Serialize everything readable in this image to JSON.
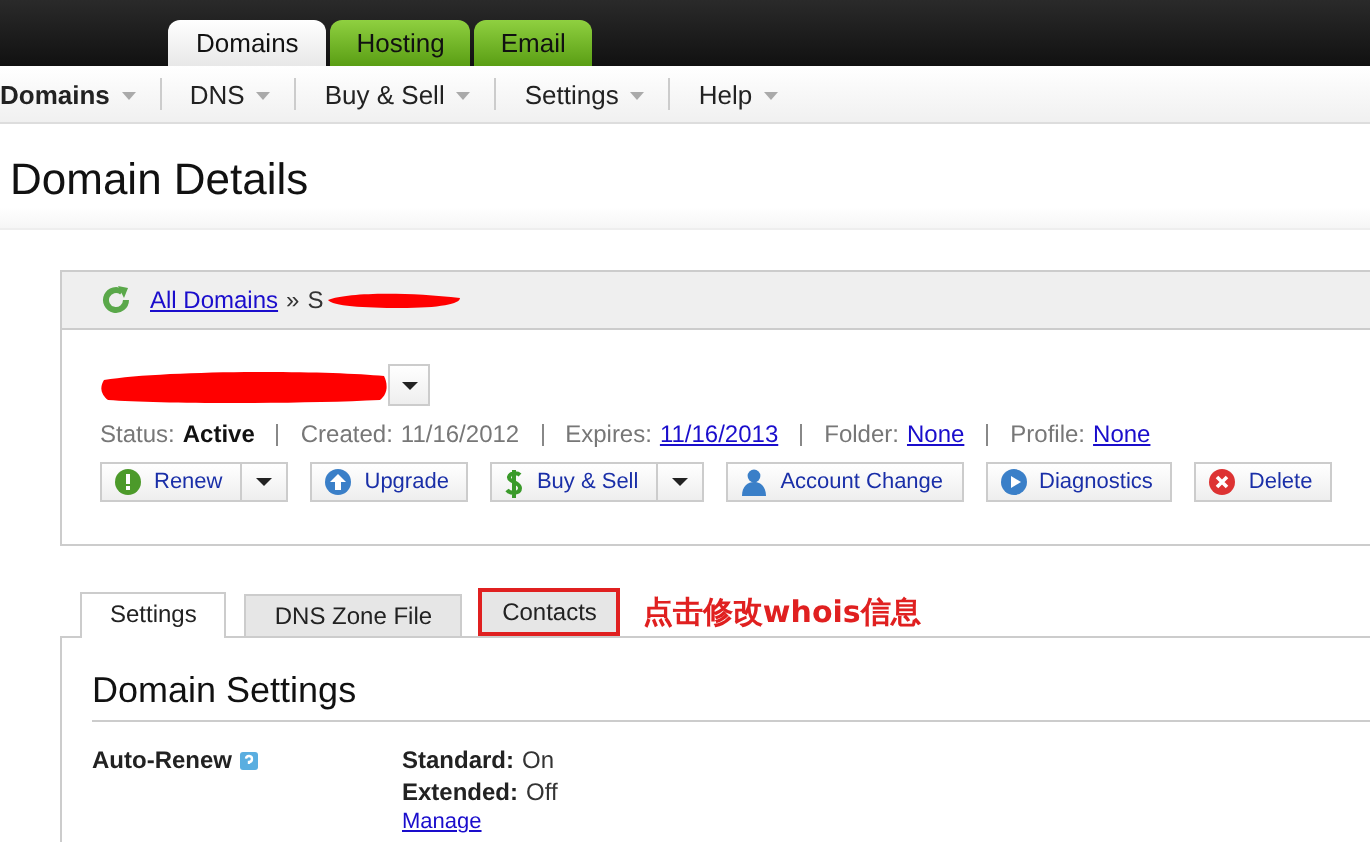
{
  "top_tabs": [
    {
      "label": "Domains",
      "selected": true
    },
    {
      "label": "Hosting",
      "selected": false
    },
    {
      "label": "Email",
      "selected": false
    }
  ],
  "nav_menu": [
    {
      "label": "Domains",
      "selected": true
    },
    {
      "label": "DNS",
      "selected": false
    },
    {
      "label": "Buy & Sell",
      "selected": false
    },
    {
      "label": "Settings",
      "selected": false
    },
    {
      "label": "Help",
      "selected": false
    }
  ],
  "page_title": "Domain Details",
  "breadcrumb": {
    "link": "All Domains",
    "separator": "»",
    "current": "S"
  },
  "status": [
    {
      "label": "Status:",
      "value": "Active",
      "kind": "bold"
    },
    {
      "label": "Created:",
      "value": "11/16/2012",
      "kind": "plain"
    },
    {
      "label": "Expires:",
      "value": "11/16/2013",
      "kind": "link"
    },
    {
      "label": "Folder:",
      "value": "None",
      "kind": "link"
    },
    {
      "label": "Profile:",
      "value": "None",
      "kind": "link"
    }
  ],
  "actions": [
    {
      "label": "Renew",
      "kind": "split"
    },
    {
      "label": "Upgrade",
      "kind": "plain"
    },
    {
      "label": "Buy & Sell",
      "kind": "split"
    },
    {
      "label": "Account Change",
      "kind": "plain"
    },
    {
      "label": "Diagnostics",
      "kind": "plain"
    },
    {
      "label": "Delete",
      "kind": "plain"
    }
  ],
  "content_tabs": [
    {
      "label": "Settings",
      "selected": true,
      "highlighted": false
    },
    {
      "label": "DNS Zone File",
      "selected": false,
      "highlighted": false
    },
    {
      "label": "Contacts",
      "selected": false,
      "highlighted": true
    }
  ],
  "annotation": "点击修改whois信息",
  "section": {
    "title": "Domain Settings",
    "rows": [
      {
        "label": "Auto-Renew",
        "lines": [
          {
            "label": "Standard:",
            "value": "On"
          },
          {
            "label": "Extended:",
            "value": "Off"
          }
        ],
        "link": "Manage"
      }
    ]
  }
}
